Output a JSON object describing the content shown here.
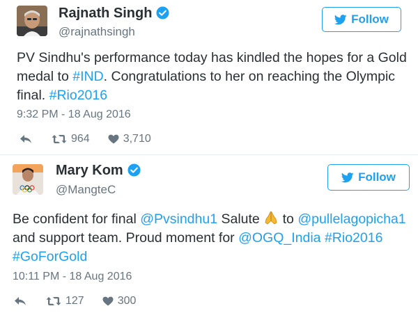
{
  "colors": {
    "accent": "#1da1f2",
    "muted": "#66757f",
    "text": "#292f33"
  },
  "tweets": [
    {
      "name": "Rajnath Singh",
      "handle": "@rajnathsingh",
      "follow_label": "Follow",
      "text_parts": [
        "PV Sindhu's performance today has kindled the hopes for a Gold medal to ",
        "#IND",
        ". Congratulations to her on reaching the Olympic final. ",
        "#Rio2016"
      ],
      "timestamp": "9:32 PM - 18 Aug 2016",
      "retweets": "964",
      "likes": "3,710"
    },
    {
      "name": "Mary Kom",
      "handle": "@MangteC",
      "follow_label": "Follow",
      "text_parts": [
        "Be confident for final ",
        "@Pvsindhu1",
        " Salute ",
        " to ",
        "@pullelagopicha1",
        " and support team. Proud moment for ",
        "@OGQ_India",
        " ",
        "#Rio2016",
        " ",
        "#GoForGold"
      ],
      "timestamp": "10:11 PM - 18 Aug 2016",
      "retweets": "127",
      "likes": "300"
    }
  ]
}
